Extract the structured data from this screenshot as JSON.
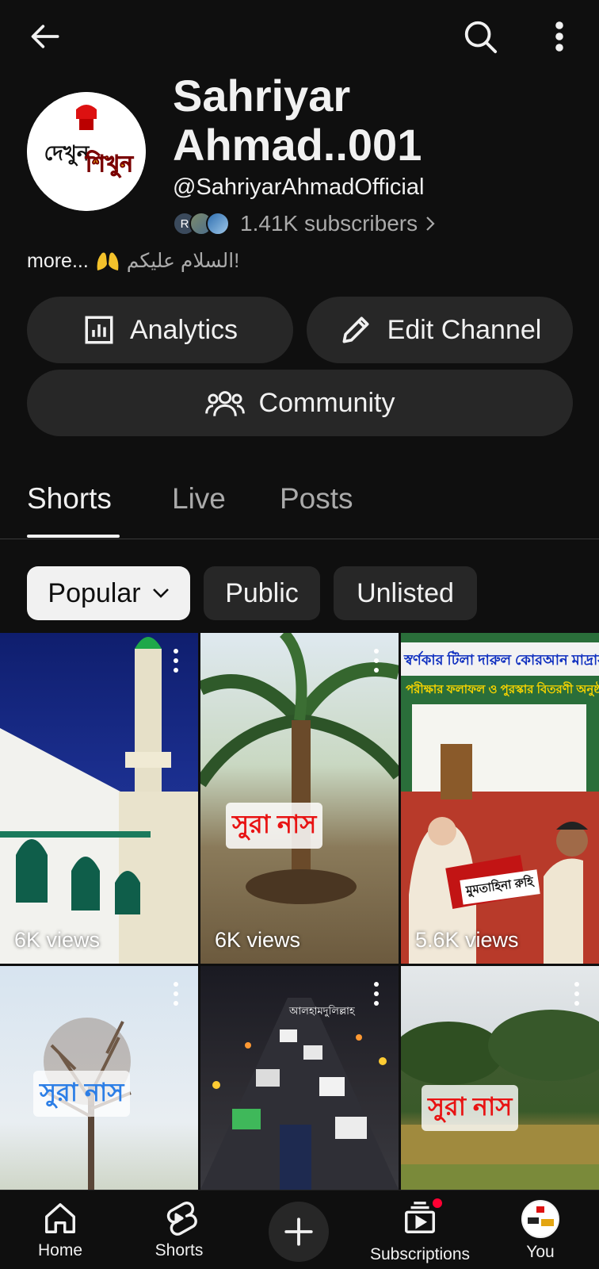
{
  "header": {
    "back_icon": "arrow-left-icon",
    "search_icon": "search-icon",
    "more_icon": "more-vertical-icon"
  },
  "channel": {
    "name": "Sahriyar Ahmad..001",
    "handle": "@SahriyarAhmadOfficial",
    "subscribers": "1.41K subscribers",
    "subscriber_avatar_initial": "R",
    "description_more": "more...",
    "description_greeting": "السلام عليكم!",
    "logo_text_1": "দেখুন",
    "logo_text_2": "শিখুন"
  },
  "actions": {
    "analytics": "Analytics",
    "edit_channel": "Edit Channel",
    "community": "Community"
  },
  "tabs": [
    {
      "label": "Shorts"
    },
    {
      "label": "Live"
    },
    {
      "label": "Posts"
    }
  ],
  "filters": [
    {
      "label": "Popular"
    },
    {
      "label": "Public"
    },
    {
      "label": "Unlisted"
    }
  ],
  "shorts": [
    {
      "views": "6K views"
    },
    {
      "views": "6K views",
      "overlay": "সুরা নাস"
    },
    {
      "views": "5.6K views",
      "banner_1": "স্বর্ণকার টিলা দারুল কোরআন মাদ্রাসা",
      "banner_2": "পরীক্ষার ফলাফল ও পুরস্কার বিতরণী অনুষ্ঠান",
      "box_label": "মুমতাহিনা রুহি"
    },
    {
      "views": "",
      "overlay": "সুরা নাস"
    },
    {
      "views": "",
      "overlay": "আলহামদুলিল্লাহ"
    },
    {
      "views": "",
      "overlay": "সুরা নাস"
    }
  ],
  "bottom_nav": {
    "home": "Home",
    "shorts": "Shorts",
    "subscriptions": "Subscriptions",
    "you": "You"
  },
  "colors": {
    "background": "#0f0f0f",
    "surface": "#272727",
    "text": "#f1f1f1",
    "muted": "#aaaaaa",
    "notification": "#ff0033"
  }
}
